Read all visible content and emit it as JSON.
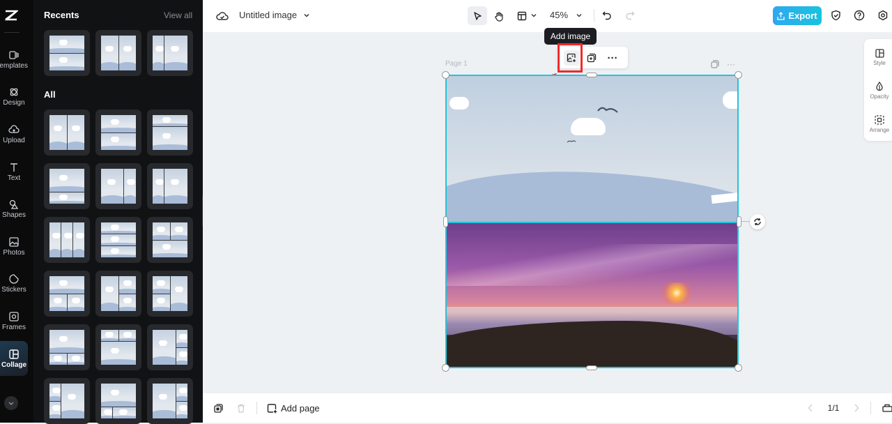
{
  "rail": {
    "items": [
      {
        "label": "Templates",
        "icon": "templates-icon"
      },
      {
        "label": "Design",
        "icon": "design-icon"
      },
      {
        "label": "Upload",
        "icon": "upload-icon"
      },
      {
        "label": "Text",
        "icon": "text-icon"
      },
      {
        "label": "Shapes",
        "icon": "shapes-icon"
      },
      {
        "label": "Photos",
        "icon": "photos-icon"
      },
      {
        "label": "Stickers",
        "icon": "stickers-icon"
      },
      {
        "label": "Frames",
        "icon": "frames-icon"
      },
      {
        "label": "Collage",
        "icon": "collage-icon",
        "active": true
      }
    ]
  },
  "panel": {
    "recents_title": "Recents",
    "view_all": "View all",
    "all_title": "All"
  },
  "topbar": {
    "title": "Untitled image",
    "zoom": "45%",
    "export": "Export"
  },
  "canvas": {
    "page_label": "Page 1",
    "tooltip": "Add image"
  },
  "right_panel": {
    "items": [
      {
        "label": "Style"
      },
      {
        "label": "Opacity"
      },
      {
        "label": "Arrange"
      }
    ]
  },
  "bottombar": {
    "add_page": "Add page",
    "page_counter": "1/1"
  },
  "colors": {
    "accent": "#23c4da",
    "highlight": "#f02a2a",
    "export_start": "#2fa8f0",
    "export_end": "#19c3dd"
  }
}
